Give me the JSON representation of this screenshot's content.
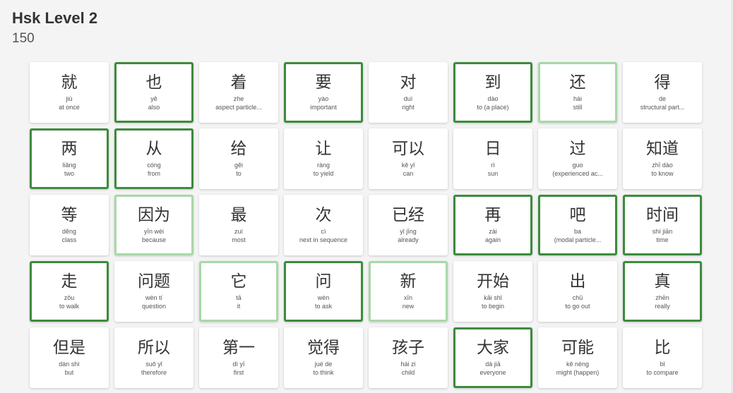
{
  "header": {
    "title": "Hsk Level 2",
    "count": "150"
  },
  "cards": [
    {
      "hanzi": "就",
      "pinyin": "jiù",
      "meaning": "at once",
      "mark": "none"
    },
    {
      "hanzi": "也",
      "pinyin": "yě",
      "meaning": "also",
      "mark": "strong"
    },
    {
      "hanzi": "着",
      "pinyin": "zhe",
      "meaning": "aspect particle...",
      "mark": "none"
    },
    {
      "hanzi": "要",
      "pinyin": "yào",
      "meaning": "important",
      "mark": "strong"
    },
    {
      "hanzi": "对",
      "pinyin": "duì",
      "meaning": "right",
      "mark": "none"
    },
    {
      "hanzi": "到",
      "pinyin": "dào",
      "meaning": "to (a place)",
      "mark": "strong"
    },
    {
      "hanzi": "还",
      "pinyin": "hái",
      "meaning": "still",
      "mark": "light"
    },
    {
      "hanzi": "得",
      "pinyin": "de",
      "meaning": "structural part...",
      "mark": "none"
    },
    {
      "hanzi": "两",
      "pinyin": "liǎng",
      "meaning": "two",
      "mark": "strong"
    },
    {
      "hanzi": "从",
      "pinyin": "cóng",
      "meaning": "from",
      "mark": "strong"
    },
    {
      "hanzi": "给",
      "pinyin": "gěi",
      "meaning": "to",
      "mark": "none"
    },
    {
      "hanzi": "让",
      "pinyin": "ràng",
      "meaning": "to yield",
      "mark": "none"
    },
    {
      "hanzi": "可以",
      "pinyin": "kě yǐ",
      "meaning": "can",
      "mark": "none"
    },
    {
      "hanzi": "日",
      "pinyin": "rì",
      "meaning": "sun",
      "mark": "none"
    },
    {
      "hanzi": "过",
      "pinyin": "guo",
      "meaning": "(experienced ac...",
      "mark": "none"
    },
    {
      "hanzi": "知道",
      "pinyin": "zhī dào",
      "meaning": "to know",
      "mark": "none"
    },
    {
      "hanzi": "等",
      "pinyin": "děng",
      "meaning": "class",
      "mark": "none"
    },
    {
      "hanzi": "因为",
      "pinyin": "yīn wèi",
      "meaning": "because",
      "mark": "light"
    },
    {
      "hanzi": "最",
      "pinyin": "zuì",
      "meaning": "most",
      "mark": "none"
    },
    {
      "hanzi": "次",
      "pinyin": "cì",
      "meaning": "next in sequence",
      "mark": "none"
    },
    {
      "hanzi": "已经",
      "pinyin": "yǐ jīng",
      "meaning": "already",
      "mark": "none"
    },
    {
      "hanzi": "再",
      "pinyin": "zài",
      "meaning": "again",
      "mark": "strong"
    },
    {
      "hanzi": "吧",
      "pinyin": "ba",
      "meaning": "(modal particle...",
      "mark": "strong"
    },
    {
      "hanzi": "时间",
      "pinyin": "shí jiān",
      "meaning": "time",
      "mark": "strong"
    },
    {
      "hanzi": "走",
      "pinyin": "zǒu",
      "meaning": "to walk",
      "mark": "strong"
    },
    {
      "hanzi": "问题",
      "pinyin": "wèn tí",
      "meaning": "question",
      "mark": "none"
    },
    {
      "hanzi": "它",
      "pinyin": "tā",
      "meaning": "it",
      "mark": "light"
    },
    {
      "hanzi": "问",
      "pinyin": "wèn",
      "meaning": "to ask",
      "mark": "strong"
    },
    {
      "hanzi": "新",
      "pinyin": "xīn",
      "meaning": "new",
      "mark": "light"
    },
    {
      "hanzi": "开始",
      "pinyin": "kāi shǐ",
      "meaning": "to begin",
      "mark": "none"
    },
    {
      "hanzi": "出",
      "pinyin": "chū",
      "meaning": "to go out",
      "mark": "none"
    },
    {
      "hanzi": "真",
      "pinyin": "zhēn",
      "meaning": "really",
      "mark": "strong"
    },
    {
      "hanzi": "但是",
      "pinyin": "dàn shì",
      "meaning": "but",
      "mark": "none"
    },
    {
      "hanzi": "所以",
      "pinyin": "suǒ yǐ",
      "meaning": "therefore",
      "mark": "none"
    },
    {
      "hanzi": "第一",
      "pinyin": "dì yī",
      "meaning": "first",
      "mark": "none"
    },
    {
      "hanzi": "觉得",
      "pinyin": "jué de",
      "meaning": "to think",
      "mark": "none"
    },
    {
      "hanzi": "孩子",
      "pinyin": "hái zi",
      "meaning": "child",
      "mark": "none"
    },
    {
      "hanzi": "大家",
      "pinyin": "dà jiā",
      "meaning": "everyone",
      "mark": "strong"
    },
    {
      "hanzi": "可能",
      "pinyin": "kě néng",
      "meaning": "might (happen)",
      "mark": "none"
    },
    {
      "hanzi": "比",
      "pinyin": "bǐ",
      "meaning": "to compare",
      "mark": "none"
    }
  ],
  "colors": {
    "strong_border": "#3d8b3d",
    "light_border": "#a8d8a8",
    "card_bg": "#ffffff",
    "page_bg": "#f4f4f4"
  }
}
